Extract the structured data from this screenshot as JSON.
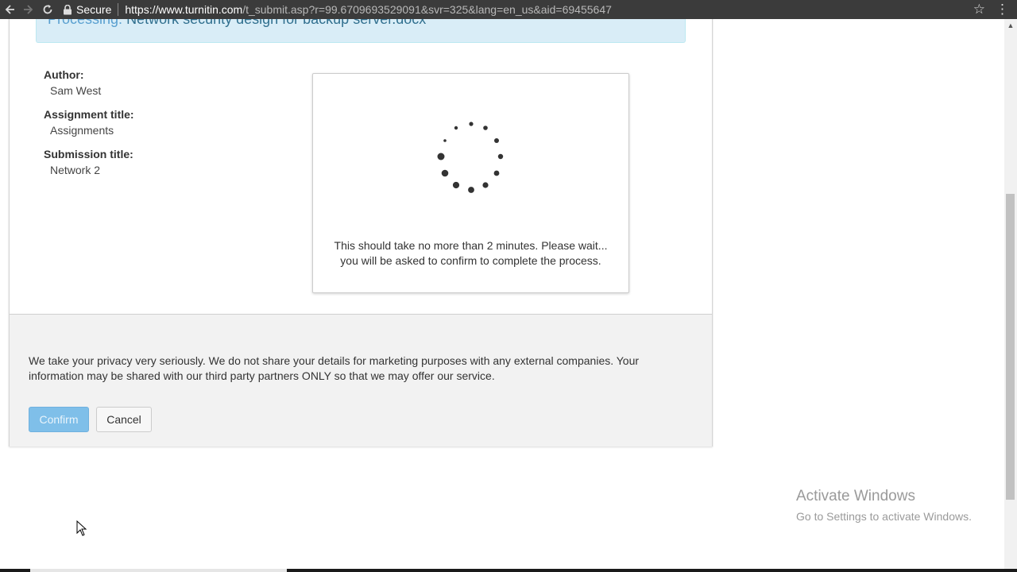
{
  "browser": {
    "secure_label": "Secure",
    "url_host": "https://www.turnitin.com",
    "url_path": "/t_submit.asp?r=99.6709693529091&svr=325&lang=en_us&aid=69455647",
    "icons": [
      "back-icon",
      "forward-icon",
      "reload-icon",
      "lock-icon",
      "star-icon",
      "menu-icon"
    ]
  },
  "alert": {
    "label": "Processing:",
    "filename": "Network security design for backup server.docx"
  },
  "meta": {
    "author_label": "Author:",
    "author_value": "Sam West",
    "assignment_label": "Assignment title:",
    "assignment_value": "Assignments",
    "submission_label": "Submission title:",
    "submission_value": "Network 2"
  },
  "processing": {
    "message": "This should take no more than 2 minutes. Please wait... you will be asked to confirm to complete the process."
  },
  "footer": {
    "privacy_text": "We take your privacy very seriously. We do not share your details for marketing purposes with any external companies. Your information may be shared with our third party partners ONLY so that we may offer our service.",
    "confirm_label": "Confirm",
    "cancel_label": "Cancel"
  },
  "watermark": {
    "title": "Activate Windows",
    "subtitle": "Go to Settings to activate Windows."
  },
  "colors": {
    "confirm_bg": "#7fbfe9",
    "alert_bg": "#d9edf7",
    "footer_bg": "#f2f2f2"
  }
}
